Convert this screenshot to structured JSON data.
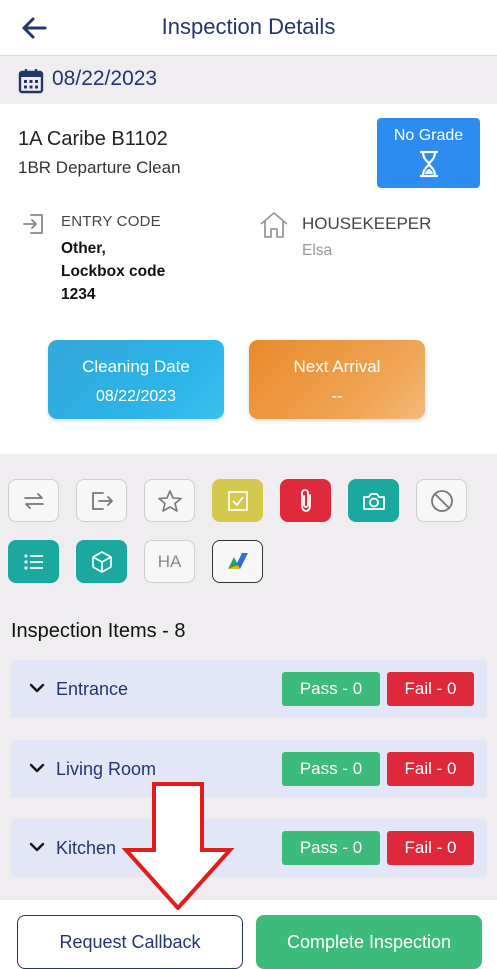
{
  "header": {
    "title": "Inspection Details",
    "back_icon": "arrow-left-icon"
  },
  "date_bar": {
    "date": "08/22/2023",
    "icon": "calendar-icon"
  },
  "unit": {
    "name": "1A Caribe B1102",
    "service": "1BR Departure Clean"
  },
  "grade": {
    "label": "No Grade",
    "icon": "hourglass-icon",
    "color": "#2d8cf0"
  },
  "entry": {
    "label": "ENTRY CODE",
    "value_lines": [
      "Other,",
      "Lockbox code",
      "1234"
    ],
    "icon": "login-icon"
  },
  "housekeeper": {
    "label": "HOUSEKEEPER",
    "name": "Elsa",
    "icon": "house-icon"
  },
  "cleaning_date": {
    "label": "Cleaning Date",
    "value": "08/22/2023"
  },
  "next_arrival": {
    "label": "Next Arrival",
    "value": "--"
  },
  "toolbar": {
    "tools": [
      {
        "icon": "swap-icon"
      },
      {
        "icon": "exit-icon"
      },
      {
        "icon": "star-icon"
      },
      {
        "icon": "checkbox-icon"
      },
      {
        "icon": "paperclip-icon"
      },
      {
        "icon": "camera-icon"
      },
      {
        "icon": "block-icon"
      },
      {
        "icon": "list-icon"
      },
      {
        "icon": "cube-icon"
      },
      {
        "label": "HA"
      },
      {
        "icon": "brand-logo-icon"
      }
    ]
  },
  "inspection_items": {
    "title": "Inspection Items - 8",
    "rows": [
      {
        "name": "Entrance",
        "pass": "Pass - 0",
        "fail": "Fail - 0"
      },
      {
        "name": "Living Room",
        "pass": "Pass - 0",
        "fail": "Fail - 0"
      },
      {
        "name": "Kitchen",
        "pass": "Pass - 0",
        "fail": "Fail - 0"
      }
    ]
  },
  "actions": {
    "request_callback": "Request Callback",
    "complete": "Complete Inspection"
  },
  "colors": {
    "accent": "#23366c",
    "pass": "#3dbb7a",
    "fail": "#e0283d",
    "teal": "#1aa89f",
    "yellow": "#d4c94e",
    "annotation_arrow": "#e21b1b"
  }
}
